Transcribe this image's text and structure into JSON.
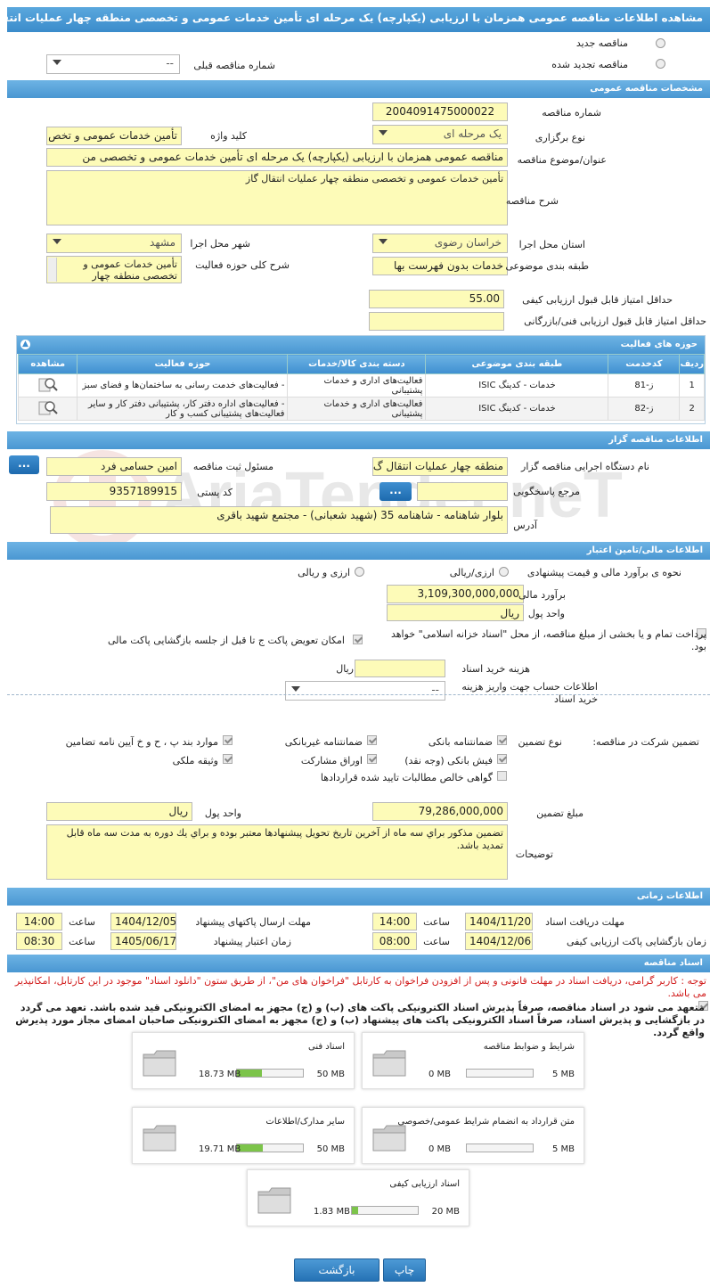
{
  "title": "مشاهده اطلاعات مناقصه عمومی همزمان با ارزیابی (یکپارچه) یک مرحله ای تأمین خدمات عمومی و تخصصی منطقه چهار عملیات انتقال گاز",
  "top": {
    "new_label": "مناقصه جدید",
    "renewed_label": "مناقصه تجدید شده",
    "prev_no_label": "شماره مناقصه قبلی",
    "prev_no_value": "--"
  },
  "general": {
    "header": "مشخصات مناقصه عمومی",
    "tender_no_label": "شماره مناقصه",
    "tender_no": "2004091475000022",
    "type_label": "نوع برگزاری",
    "type_value": "یک مرحله ای",
    "keyword_label": "کلید واژه",
    "keyword_value": "تأمین خدمات عمومی و تخص",
    "subject_label": "عنوان/موضوع مناقصه",
    "subject_value": "مناقصه عمومی همزمان با ارزیابی (یکپارچه) یک مرحله ای تأمین خدمات عمومی و تخصصی من",
    "desc_label": "شرح مناقصه",
    "desc_value": "تأمین خدمات عمومی و تخصصی منطقه چهار عملیات انتقال گاز",
    "province_label": "استان محل اجرا",
    "province_value": "خراسان رضوی",
    "city_label": "شهر محل اجرا",
    "city_value": "مشهد",
    "category_label": "طبقه بندی موضوعی",
    "category_value": "خدمات بدون فهرست بها",
    "scope_label": "شرح کلی حوزه فعالیت",
    "scope_value": "تأمین خدمات عمومی و تخصصی منطقه چهار",
    "min_quality_label": "حداقل امتیاز قابل قبول ارزیابی کیفی",
    "min_quality_value": "55.00",
    "min_tech_label": "حداقل امتیاز قابل قبول ارزیابی فنی/بازرگانی",
    "min_tech_value": ""
  },
  "activities": {
    "header": "حوزه های فعالیت",
    "columns": [
      "ردیف",
      "کدخدمت",
      "طبقه بندی موضوعی",
      "دسته بندی کالا/خدمات",
      "حوزه فعالیت",
      "مشاهده"
    ],
    "rows": [
      {
        "idx": "1",
        "code": "ز-81",
        "cat": "خدمات - کدینگ ISIC",
        "group": "فعالیت‌های اداری و خدمات پشتیبانی",
        "area": "- فعالیت‌های خدمت رسانی به ساختمان‌ها و فضای سبز"
      },
      {
        "idx": "2",
        "code": "ز-82",
        "cat": "خدمات - کدینگ ISIC",
        "group": "فعالیت‌های اداری و خدمات پشتیبانی",
        "area": "- فعالیت‌های اداره دفتر کار، پشتیبانی دفتر کار و سایر فعالیت‌های پشتیبانی کسب و کار"
      }
    ]
  },
  "organizer": {
    "header": "اطلاعات مناقصه گزار",
    "org_label": "نام دستگاه اجرایی مناقصه گزار",
    "org_value": "منطقه چهار عملیات انتقال گ",
    "resp_label": "مسئول ثبت مناقصه",
    "resp_value": "امین حسامی فرد",
    "ref_label": "مرجع پاسخگویی",
    "ref_value": "",
    "postal_label": "کد پستی",
    "postal_value": "9357189915",
    "address_label": "آدرس",
    "address_value": "بلوار شاهنامه - شاهنامه 35 (شهید شعبانی) - مجتمع شهید باقری",
    "dots": "..."
  },
  "finance": {
    "header": "اطلاعات مالی/تامین اعتبار",
    "method_label": "نحوه ی برآورد مالی و قیمت پیشنهادی",
    "opt1": "ارزی/ریالی",
    "opt2": "ارزی و ریالی",
    "estimate_label": "برآورد مالی",
    "estimate_value": "3,109,300,000,000",
    "currency_label": "واحد پول",
    "currency_value": "ریال",
    "partial_label": "پرداخت تمام و یا بخشی از مبلغ مناقصه، از محل \"اسناد خزانه اسلامی\" خواهد بود.",
    "swap_label": "امکان تعویض پاکت ج تا قبل از جلسه بازگشایی پاکت مالی",
    "doc_cost_label": "هزینه خرید اسناد",
    "doc_cost_unit": "ریال",
    "doc_cost_value": "",
    "account_label": "اطلاعات حساب جهت واریز هزینه خرید اسناد",
    "account_value": "--"
  },
  "guarantee": {
    "label": "تضمین شرکت در مناقصه:",
    "type_label": "نوع تضمین",
    "items": [
      "ضمانتنامه بانکی",
      "ضمانتنامه غیربانکی",
      "موارد بند پ ، ح و خ آیین نامه تضامین",
      "فیش بانکی (وجه نقد)",
      "اوراق مشارکت",
      "وثیقه ملکی",
      "گواهی خالص مطالبات تایید شده قراردادها"
    ],
    "amount_label": "مبلغ تضمین",
    "amount_value": "79,286,000,000",
    "currency_label": "واحد پول",
    "currency_value": "ریال",
    "notes_label": "توضیحات",
    "notes_value": "تضمين مذكور براي سه ماه از آخرين تاريخ تحويل پيشنهادها معتبر بوده و براي يك دوره به مدت سه ماه قابل تمديد باشد."
  },
  "timing": {
    "header": "اطلاعات زمانی",
    "receive_label": "مهلت دریافت اسناد",
    "receive_date": "1404/11/20",
    "receive_time": "14:00",
    "send_label": "مهلت ارسال پاکتهای پیشنهاد",
    "send_date": "1404/12/05",
    "send_time": "14:00",
    "open_label": "زمان بازگشایی پاکت ارزیابی کیفی",
    "open_date": "1404/12/06",
    "open_time": "08:00",
    "valid_label": "زمان اعتبار پیشنهاد",
    "valid_date": "1405/06/17",
    "valid_time": "08:30",
    "time_label": "ساعت"
  },
  "documents": {
    "header": "اسناد مناقصه",
    "note": "توجه : کاربر گرامی، دریافت اسناد در مهلت قانونی و پس از افزودن فراخوان به کارتابل \"فراخوان های من\"، از طریق ستون \"دانلود اسناد\" موجود در این کارتابل، امکانپذیر می باشد.",
    "commit": "متعهد می شود در اسناد مناقصه، صرفاً پذیرش اسناد الکترونیکی پاکت های (ب) و (ج) مجهز به امضای الکترونیکی قید شده باشد. تعهد می گردد در بازگشایی و پذیرش اسناد، صرفاً اسناد الکترونیکی پاکت های پیشنهاد (ب) و (ج) مجهز به امضای الکترونیکی صاحبان امضای مجاز مورد پذیرش واقع گردد.",
    "files": [
      {
        "name": "شرایط و ضوابط مناقصه",
        "cur": "0 MB",
        "max": "5 MB",
        "fill": 0
      },
      {
        "name": "اسناد فنی",
        "cur": "18.73 MB",
        "max": "50 MB",
        "fill": 0.3746
      },
      {
        "name": "متن قرارداد به انضمام شرایط عمومی/خصوصی",
        "cur": "0 MB",
        "max": "5 MB",
        "fill": 0
      },
      {
        "name": "سایر مدارک/اطلاعات",
        "cur": "19.71 MB",
        "max": "50 MB",
        "fill": 0.3942
      },
      {
        "name": "اسناد ارزیابی کیفی",
        "cur": "1.83 MB",
        "max": "20 MB",
        "fill": 0.0915
      }
    ]
  },
  "buttons": {
    "print": "چاپ",
    "back": "بازگشت"
  },
  "watermark": "AriaTender.neT"
}
